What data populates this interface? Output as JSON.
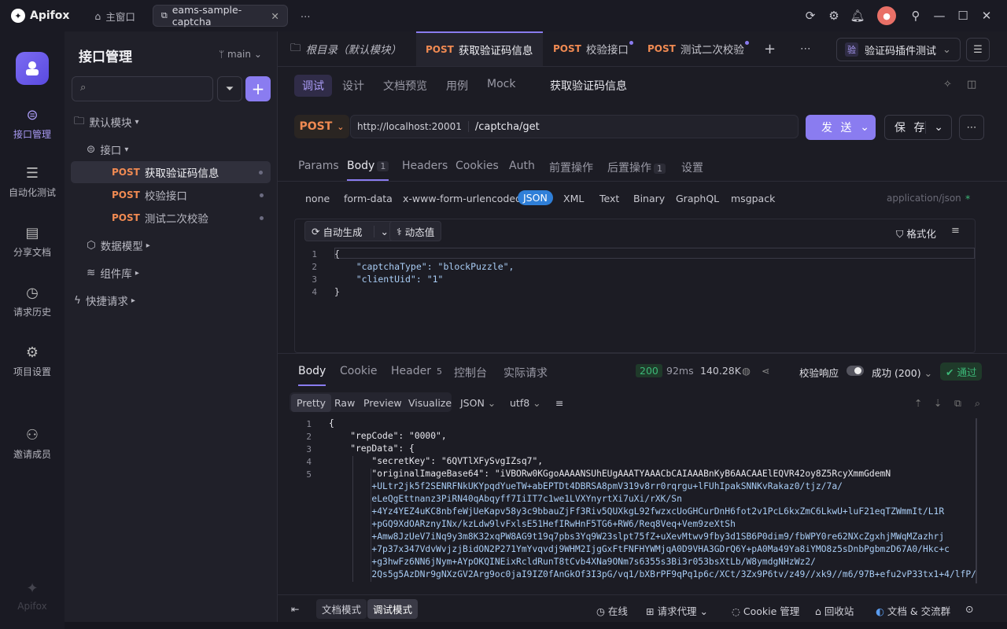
{
  "app": {
    "name": "Apifox"
  },
  "window_tabs": [
    {
      "label": "主窗口"
    },
    {
      "label": "eams-sample-captcha"
    }
  ],
  "rail": {
    "items": [
      {
        "label": "接口管理"
      },
      {
        "label": "自动化测试"
      },
      {
        "label": "分享文档"
      },
      {
        "label": "请求历史"
      },
      {
        "label": "项目设置"
      },
      {
        "label": "邀请成员"
      }
    ],
    "footer": "Apifox"
  },
  "sidebar": {
    "title": "接口管理",
    "branch": "main",
    "tree": [
      {
        "label": "默认模块"
      },
      {
        "label": "接口"
      },
      {
        "method": "POST",
        "label": "获取验证码信息"
      },
      {
        "method": "POST",
        "label": "校验接口"
      },
      {
        "method": "POST",
        "label": "测试二次校验"
      },
      {
        "label": "数据模型"
      },
      {
        "label": "组件库"
      },
      {
        "label": "快捷请求"
      }
    ]
  },
  "request_tabs": [
    {
      "label": "根目录（默认模块）"
    },
    {
      "method": "POST",
      "label": "获取验证码信息"
    },
    {
      "method": "POST",
      "label": "校验接口"
    },
    {
      "method": "POST",
      "label": "测试二次校验"
    }
  ],
  "environment": {
    "badge": "验",
    "label": "验证码插件测试"
  },
  "subtabs": [
    "调试",
    "设计",
    "文档预览",
    "用例",
    "Mock"
  ],
  "request_title": "获取验证码信息",
  "request": {
    "method": "POST",
    "base_url": "http://localhost:20001",
    "path": "/captcha/get",
    "send_label": "发 送",
    "save_label": "保 存"
  },
  "param_tabs": [
    {
      "label": "Params"
    },
    {
      "label": "Body",
      "count": "1"
    },
    {
      "label": "Headers"
    },
    {
      "label": "Cookies"
    },
    {
      "label": "Auth"
    },
    {
      "label": "前置操作"
    },
    {
      "label": "后置操作",
      "count": "1"
    },
    {
      "label": "设置"
    }
  ],
  "body_types": [
    "none",
    "form-data",
    "x-www-form-urlencoded",
    "JSON",
    "XML",
    "Text",
    "Binary",
    "GraphQL",
    "msgpack"
  ],
  "content_type": "application/json",
  "editor_toolbar": {
    "auto_gen": "自动生成",
    "dynamic": "动态值",
    "format": "格式化"
  },
  "request_body": {
    "lines": [
      "{",
      "    \"captchaType\": \"blockPuzzle\",",
      "    \"clientUid\": \"1\"",
      "}"
    ]
  },
  "response_tabs": [
    {
      "label": "Body"
    },
    {
      "label": "Cookie"
    },
    {
      "label": "Header",
      "count": "5"
    },
    {
      "label": "控制台"
    },
    {
      "label": "实际请求"
    }
  ],
  "response_meta": {
    "status": "200",
    "time": "92ms",
    "size": "140.28K",
    "validate_label": "校验响应",
    "result": "成功 (200)",
    "pass": "通过"
  },
  "view_tabs": [
    "Pretty",
    "Raw",
    "Preview",
    "Visualize"
  ],
  "view_format": "JSON",
  "view_encoding": "utf8",
  "response_body": {
    "lines": [
      "{",
      "    \"repCode\": \"0000\",",
      "    \"repData\": {",
      "        \"secretKey\": \"6QVTlXFySvgIZsq7\",",
      "        \"originalImageBase64\": \"iVBORw0KGgoAAAANSUhEUgAAATYAAACbCAIAAABnKyB6AACAAElEQVR42oy8Z5RcyXmmGdemN",
      "        +ULtr2jk5f2SENRFNkUKYpqdYueTW+abEPTDt4DBRSA8pmV319v8rr0rqrgu+lFUhIpakSNNKvRakaz0/tjz/7a/",
      "        eLeQgEttnanz3PiRN40qAbqyff7IiIT7c1we1LVXYnyrtXi7uXi/rXK/Sn",
      "        +4Yz4YEZ4uKC8nbfeWjUeKapv58y3c9bbauZjFf3Riv5QUXkgL92fwzxcUoGHCurDnH6fot2v1PcL6kxZmC6LkwU+luF21eqTZWmmIt/L1R",
      "        +pGQ9XdOARznyINx/kzLdw9lvFxlsE51HefIRwHnF5TG6+RW6/Req8Veq+Vem9zeXtSh",
      "        +Amw8JzUeV7iNq9y3m8K32xqPW8AG9t19q7pbs3Yq9W23slpt75fZ+uXevMtwv9fby3d1SB6P0dim9/fbWPY0re62NXcZgxhjMWqMZazhrj",
      "        +7p37x347VdvWvjzjBidON2P271YmYvqvdj9WHM2IjgGxFtFNFHYWMjqA0D9VHA3GDrQ6Y+pA0Ma49Ya8iYMO8z5sDnbPgbmzD67A0/Hkc+c",
      "        +g3hwFz6NN6jNym+AYpOKQINEixRcldRunT8tCvb4XNa9ONm7s6355s3Bi3r053bsXtLb/W8ymdgNHzWz2/",
      "        2Qs5g5AzDNr9gNXzGV2Arg9oc0jaI9IZ0fAnGkOf3I3pG/vq1/bXBrPF9qPq1p6c/XCt/3Zx9P6tv/z49//xk9//m6/97B+efu2vP33tx1+4/lfP/"
    ]
  },
  "bottom": {
    "doc_mode": "文档模式",
    "debug_mode": "调试模式",
    "online": "在线",
    "proxy": "请求代理",
    "cookie": "Cookie 管理",
    "recycle": "回收站",
    "community": "文档 & 交流群"
  }
}
